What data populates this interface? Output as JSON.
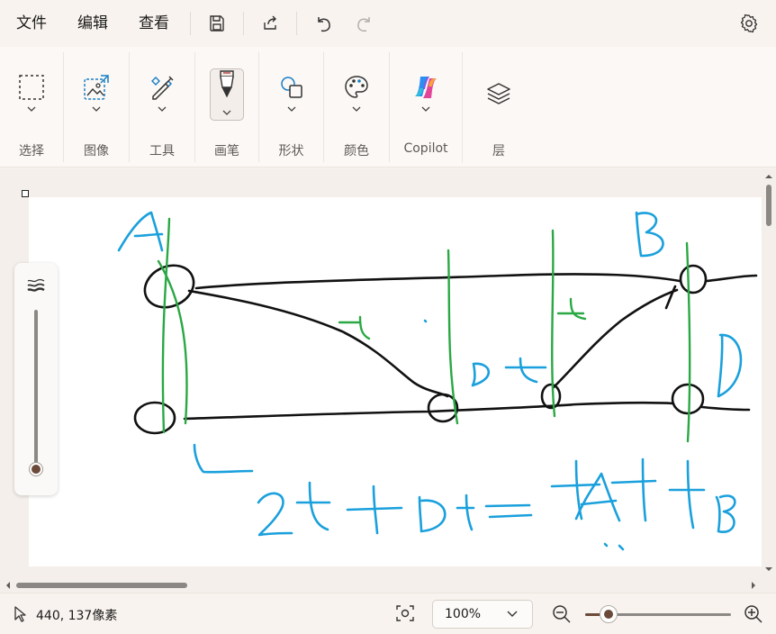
{
  "menu": {
    "file": "文件",
    "edit": "编辑",
    "view": "查看"
  },
  "ribbon": {
    "groups": [
      {
        "label": "选择",
        "icon": "select-icon"
      },
      {
        "label": "图像",
        "icon": "image-icon"
      },
      {
        "label": "工具",
        "icon": "tools-icon"
      },
      {
        "label": "画笔",
        "icon": "brush-icon"
      },
      {
        "label": "形状",
        "icon": "shapes-icon"
      },
      {
        "label": "颜色",
        "icon": "palette-icon"
      },
      {
        "label": "Copilot",
        "icon": "copilot-icon"
      },
      {
        "label": "层",
        "icon": "layers-icon"
      }
    ]
  },
  "status": {
    "coordinates": "440, 137像素",
    "zoom": "100%"
  },
  "colors": {
    "accent": "#6b4a3a",
    "ink_black": "#111111",
    "ink_green": "#2aa843",
    "ink_blue": "#1aa0dc"
  }
}
